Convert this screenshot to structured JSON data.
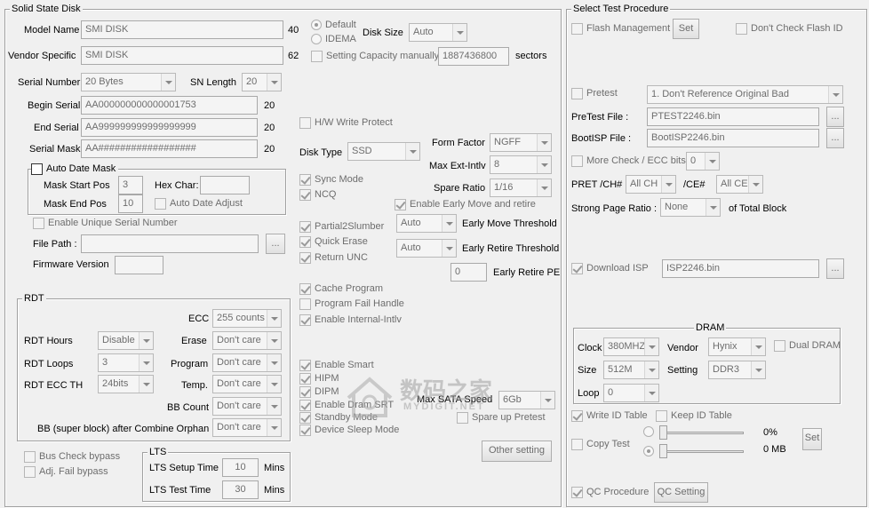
{
  "ssd": {
    "title": "Solid State Disk",
    "model_name_label": "Model Name",
    "model_name": "SMI DISK",
    "model_len": "40",
    "vendor_label": "Vendor Specific",
    "vendor": "SMI DISK",
    "vendor_len": "62",
    "default_label": "Default",
    "idema_label": "IDEMA",
    "disk_size_label": "Disk Size",
    "disk_size": "Auto",
    "set_cap_label": "Setting Capacity manually",
    "capacity": "1887436800",
    "sectors_label": "sectors",
    "serial_label": "Serial Number",
    "serial": "20 Bytes",
    "sn_len_label": "SN Length",
    "sn_len": "20",
    "begin_serial_label": "Begin Serial",
    "begin_serial": "AA000000000000001753",
    "begin_len": "20",
    "end_serial_label": "End Serial",
    "end_serial": "AA999999999999999999",
    "end_len": "20",
    "serial_mask_label": "Serial Mask",
    "serial_mask": "AA##################",
    "mask_len": "20",
    "auto_date_label": "Auto Date Mask",
    "mask_start_label": "Mask Start Pos",
    "mask_start": "3",
    "hex_char_label": "Hex Char:",
    "mask_end_label": "Mask End Pos",
    "mask_end": "10",
    "auto_date_adjust_label": "Auto Date Adjust",
    "unique_serial_label": "Enable Unique Serial Number",
    "file_path_label": "File Path :",
    "browse": "...",
    "firmware_label": "Firmware Version",
    "hw_wp_label": "H/W Write Protect",
    "disk_type_label": "Disk Type",
    "disk_type": "SSD",
    "form_factor_label": "Form Factor",
    "form_factor": "NGFF",
    "max_ext_label": "Max Ext-Intlv",
    "max_ext": "8",
    "spare_label": "Spare Ratio",
    "spare": "1/16",
    "sync_label": "Sync Mode",
    "ncq_label": "NCQ",
    "early_move_label": "Enable Early Move and retire",
    "partial_label": "Partial2Slumber",
    "quick_erase_label": "Quick Erase",
    "return_unc_label": "Return UNC",
    "emt_sel": "Auto",
    "emt_label": "Early Move Threshold",
    "ert_sel": "Auto",
    "ert_label": "Early Retire Threshold",
    "erpe_val": "0",
    "erpe_label": "Early Retire PE",
    "cache_label": "Cache Program",
    "pfh_label": "Program Fail Handle",
    "internal_label": "Enable Internal-Intlv",
    "smart_label": "Enable Smart",
    "hipm_label": "HIPM",
    "dipm_label": "DIPM",
    "dram_srt_label": "Enable Dram SRT",
    "standby_label": "Standby Mode",
    "dsm_label": "Device Sleep Mode",
    "sata_label": "Max SATA Speed",
    "sata": "6Gb",
    "spare_pretest_label": "Spare up Pretest",
    "other_setting": "Other setting"
  },
  "rdt": {
    "title": "RDT",
    "ecc_label": "ECC",
    "ecc": "255 counts",
    "hours_label": "RDT Hours",
    "hours": "Disable",
    "erase_label": "Erase",
    "erase": "Don't care",
    "loops_label": "RDT Loops",
    "loops": "3",
    "program_label": "Program",
    "program": "Don't care",
    "ecc_th_label": "RDT ECC TH",
    "ecc_th": "24bits",
    "temp_label": "Temp.",
    "temp": "Don't care",
    "bb_count_label": "BB Count",
    "bb_count": "Don't care",
    "bb_orphan_label": "BB (super block) after Combine Orphan",
    "bb_orphan": "Don't care"
  },
  "bypass": {
    "bus_label": "Bus Check bypass",
    "adj_label": "Adj. Fail bypass"
  },
  "lts": {
    "title": "LTS",
    "setup_label": "LTS Setup Time",
    "setup": "10",
    "test_label": "LTS Test Time",
    "test": "30",
    "mins": "Mins"
  },
  "proc": {
    "title": "Select Test Procedure",
    "flash_label": "Flash Management",
    "set": "Set",
    "dont_check_label": "Don't Check Flash ID",
    "pretest_label": "Pretest",
    "pretest": "1. Don't Reference Original Bad",
    "pretest_file_label": "PreTest File :",
    "pretest_file": "PTEST2246.bin",
    "bootisp_label": "BootISP File :",
    "bootisp": "BootISP2246.bin",
    "browse": "...",
    "more_check_label": "More Check / ECC bits",
    "more_check": "0",
    "pret_label": "PRET /CH#",
    "pret_ch": "All CH",
    "ce_label": "/CE#",
    "pret_ce": "All CE",
    "strong_label": "Strong Page Ratio :",
    "strong": "None",
    "of_total_label": "of Total Block",
    "download_label": "Download ISP",
    "download_file": "ISP2246.bin"
  },
  "dram": {
    "title": "DRAM",
    "clock_label": "Clock",
    "clock": "380MHZ",
    "vendor_label": "Vendor",
    "vendor": "Hynix",
    "dual_label": "Dual DRAM",
    "size_label": "Size",
    "size": "512M",
    "setting_label": "Setting",
    "setting": "DDR3",
    "loop_label": "Loop",
    "loop": "0"
  },
  "misc": {
    "write_id_label": "Write ID Table",
    "keep_id_label": "Keep ID Table",
    "copy_test_label": "Copy Test",
    "pct": "0%",
    "mb": "0 MB",
    "set": "Set",
    "qc_label": "QC Procedure",
    "qc_setting": "QC Setting"
  },
  "watermark": {
    "text": "数码之家",
    "sub": "MYDIGIT.NET"
  }
}
